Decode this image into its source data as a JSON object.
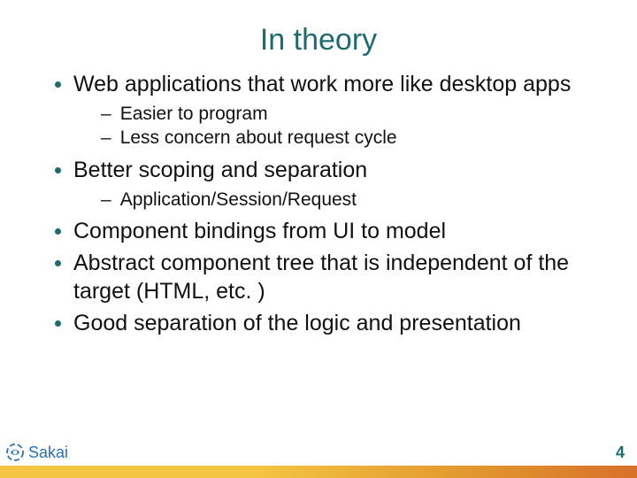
{
  "title": "In theory",
  "bullets": [
    {
      "text": "Web applications that work more like desktop apps",
      "sub": [
        "Easier to program",
        "Less concern about request cycle"
      ]
    },
    {
      "text": "Better scoping and separation",
      "sub": [
        "Application/Session/Request"
      ]
    },
    {
      "text": "Component bindings from UI to model",
      "sub": []
    },
    {
      "text": "Abstract component tree that is independent of the target (HTML, etc. )",
      "sub": []
    },
    {
      "text": "Good separation of the logic and presentation",
      "sub": []
    }
  ],
  "logo_text": "Sakai",
  "page_number": "4"
}
